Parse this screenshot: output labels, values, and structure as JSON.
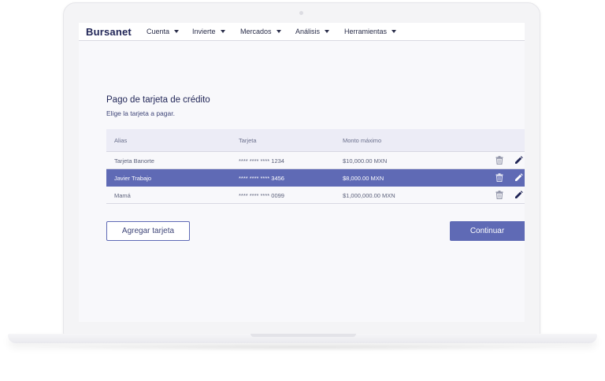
{
  "app": {
    "brand": "Bursanet"
  },
  "nav": {
    "items": [
      {
        "label": "Cuenta"
      },
      {
        "label": "Invierte"
      },
      {
        "label": "Mercados"
      },
      {
        "label": "Análisis"
      },
      {
        "label": "Herramientas"
      }
    ]
  },
  "page": {
    "title": "Pago de tarjeta de crédito",
    "subtitle": "Elige la tarjeta a pagar."
  },
  "table": {
    "columns": [
      "Alias",
      "Tarjeta",
      "Monto máximo"
    ],
    "rows": [
      {
        "alias": "Tarjeta Banorte",
        "card": "**** **** **** 1234",
        "max": "$10,000.00 MXN",
        "selected": false
      },
      {
        "alias": "Javier Trabajo",
        "card": "**** **** **** 3456",
        "max": "$8,000.00 MXN",
        "selected": true
      },
      {
        "alias": "Mamá",
        "card": "**** **** **** 0099",
        "max": "$1,000,000.00 MXN",
        "selected": false
      }
    ],
    "row_icons": [
      "trash-icon",
      "pencil-icon"
    ]
  },
  "actions": {
    "add_label": "Agregar tarjeta",
    "continue_label": "Continuar"
  },
  "colors": {
    "brand": "#1f2456",
    "accent": "#5f6ab5",
    "header_bg": "#ececf6",
    "screen_bg": "#f8f8fb"
  }
}
